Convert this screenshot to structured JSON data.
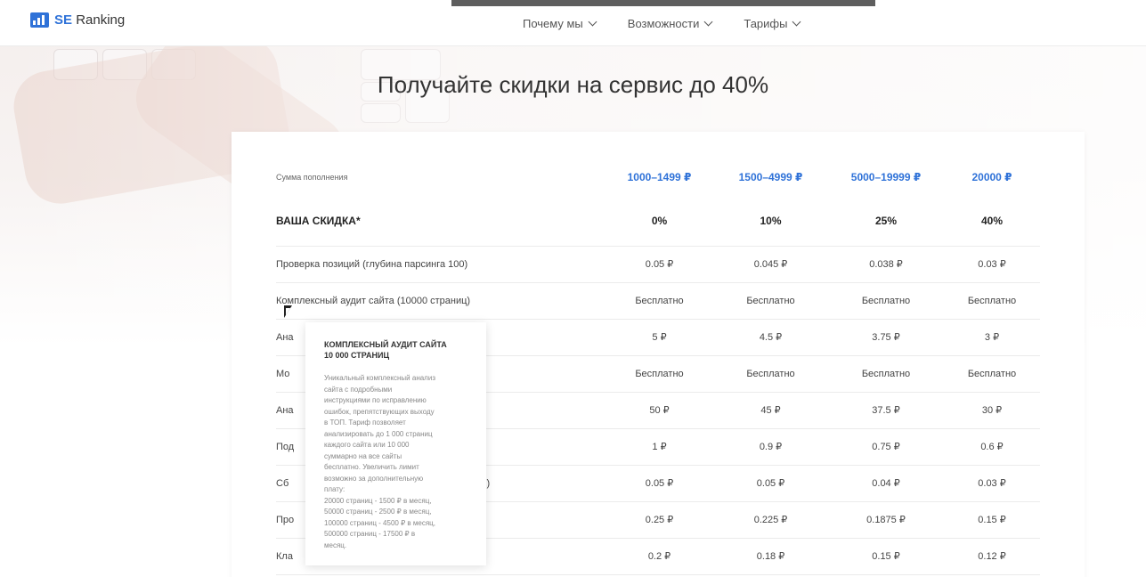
{
  "header": {
    "logo_prefix": "SE",
    "logo_suffix": "Ranking",
    "nav": [
      {
        "label": "Почему мы"
      },
      {
        "label": "Возможности"
      },
      {
        "label": "Тарифы"
      }
    ]
  },
  "title": "Получайте скидки на сервис до 40%",
  "table": {
    "amount_label": "Сумма пополнения",
    "amounts": [
      "1000–1499 ₽",
      "1500–4999 ₽",
      "5000–19999 ₽",
      "20000 ₽"
    ],
    "discount_label": "ВАША СКИДКА*",
    "discounts": [
      "0%",
      "10%",
      "25%",
      "40%"
    ],
    "rows": [
      {
        "label": "Проверка позиций (глубина парсинга 100)",
        "values": [
          "0.05 ₽",
          "0.045 ₽",
          "0.038 ₽",
          "0.03 ₽"
        ]
      },
      {
        "label": "Комплексный аудит сайта (10000 страниц)",
        "values": [
          "Бесплатно",
          "Бесплатно",
          "Бесплатно",
          "Бесплатно"
        ]
      },
      {
        "label": "Ана",
        "values": [
          "5 ₽",
          "4.5 ₽",
          "3.75 ₽",
          "3 ₽"
        ]
      },
      {
        "label": "Мо                                                              млок)",
        "values": [
          "Бесплатно",
          "Бесплатно",
          "Бесплатно",
          "Бесплатно"
        ]
      },
      {
        "label": "Ана",
        "values": [
          "50 ₽",
          "45 ₽",
          "37.5 ₽",
          "30 ₽"
        ]
      },
      {
        "label": "Под                                                             stat",
        "values": [
          "1 ₽",
          "0.9 ₽",
          "0.75 ₽",
          "0.6 ₽"
        ]
      },
      {
        "label": "Сб                                                              сть 3Х)",
        "values": [
          "0.05 ₽",
          "0.05 ₽",
          "0.04 ₽",
          "0.03 ₽"
        ]
      },
      {
        "label": "Про",
        "values": [
          "0.25 ₽",
          "0.225 ₽",
          "0.1875 ₽",
          "0.15 ₽"
        ]
      },
      {
        "label": "Кла",
        "values": [
          "0.2 ₽",
          "0.18 ₽",
          "0.15 ₽",
          "0.12 ₽"
        ]
      }
    ]
  },
  "tooltip": {
    "title": "КОМПЛЕКСНЫЙ АУДИТ САЙТА\n10 000 СТРАНИЦ",
    "body": "Уникальный комплексный анализ\nсайта с подробными\nинструкциями по исправлению\nошибок, препятствующих выходу\nв ТОП. Тариф позволяет\nанализировать до 1 000 страниц\nкаждого сайта или 10 000\nсуммарно на все сайты\nбесплатно. Увеличить лимит\nвозможно за дополнительную\nплату:\n20000 страниц - 1500 ₽ в месяц,\n50000 страниц - 2500 ₽ в месяц,\n100000 страниц - 4500 ₽ в месяц,\n500000 страниц - 17500 ₽ в\nмесяц."
  },
  "colors": {
    "accent": "#2f72d8"
  }
}
